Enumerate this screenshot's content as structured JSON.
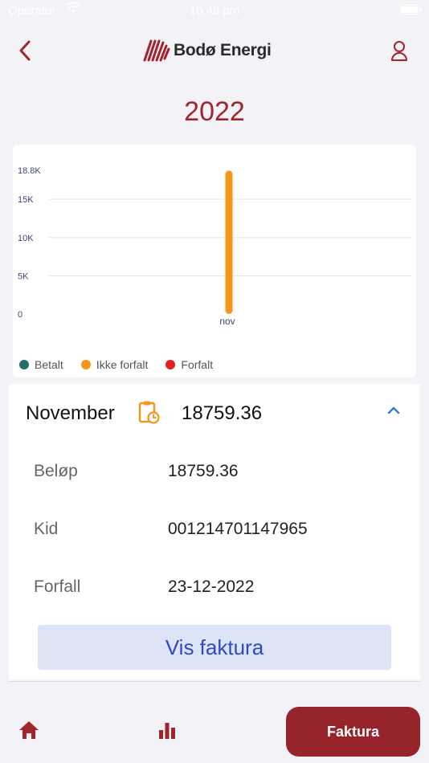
{
  "status_bar": {
    "carrier": "Operator",
    "time": "10:48 pm"
  },
  "brand": {
    "name": "Bodø Energi"
  },
  "year": "2022",
  "colors": {
    "accent": "#a0252c",
    "betalt": "#1f6e6a",
    "ikke_forfalt": "#f3961a",
    "forfalt": "#e61e1e",
    "button_bg": "#dde4f6",
    "button_text": "#2f4bc2"
  },
  "chart_data": {
    "type": "bar",
    "categories": [
      "nov"
    ],
    "series": [
      {
        "name": "Ikke forfalt",
        "values": [
          18759.36
        ]
      }
    ],
    "ytick_labels": [
      "0",
      "5K",
      "10K",
      "15K",
      "18.8K"
    ],
    "yticks": [
      0,
      5000,
      10000,
      15000,
      18800
    ],
    "ylim": [
      0,
      18800
    ],
    "grid": true,
    "legend": [
      "Betalt",
      "Ikke forfalt",
      "Forfalt"
    ],
    "legend_position": "bottom-left"
  },
  "invoice": {
    "month": "November",
    "amount": "18759.36",
    "details": [
      {
        "label": "Beløp",
        "value": "18759.36"
      },
      {
        "label": "Kid",
        "value": "001214701147965"
      },
      {
        "label": "Forfall",
        "value": "23-12-2022"
      }
    ],
    "button_label": "Vis faktura"
  },
  "bottom_nav": {
    "faktura_label": "Faktura",
    "home_icon": "home-icon",
    "stats_icon": "bar-chart-icon"
  }
}
